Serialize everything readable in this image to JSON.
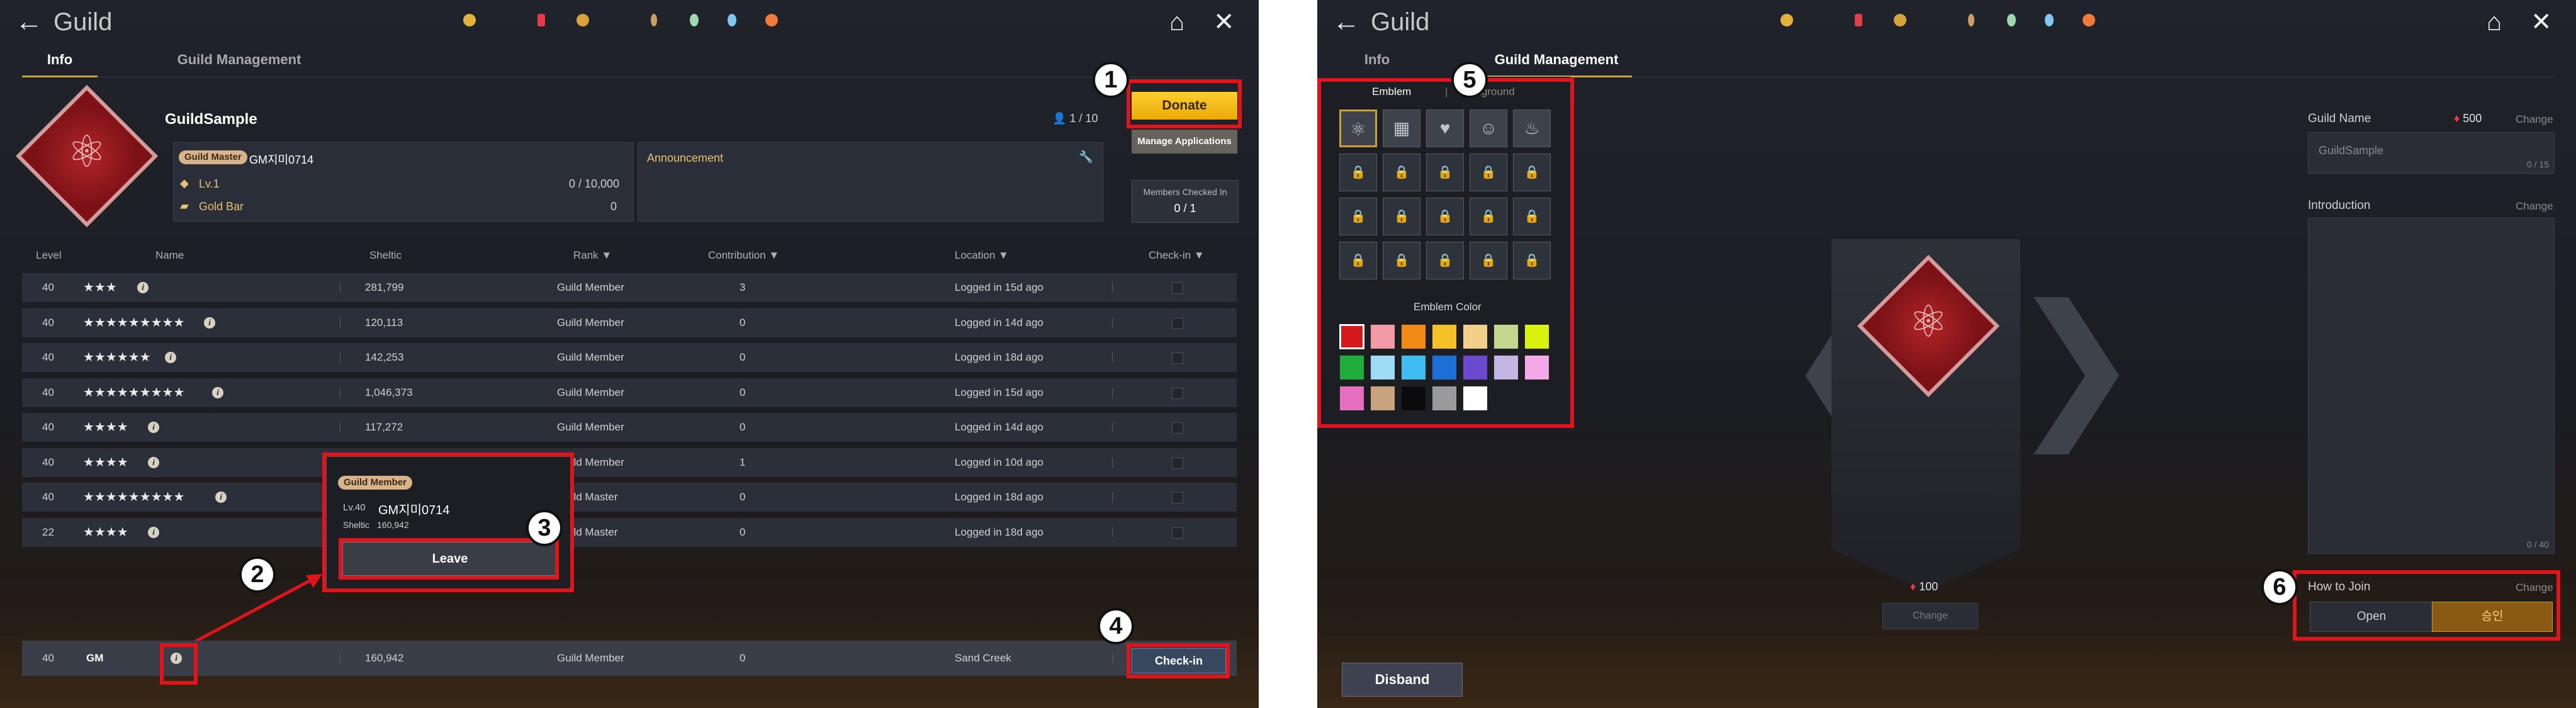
{
  "left": {
    "header": {
      "back_icon": "arrow-left-icon",
      "title": "Guild"
    },
    "tabs": [
      {
        "label": "Info",
        "active": true
      },
      {
        "label": "Guild Management",
        "active": false
      }
    ],
    "guild": {
      "name": "GuildSample",
      "member_count": "1 / 10",
      "master_badge": "Guild Master",
      "master_name": "GM지미0714",
      "level": "Lv.1",
      "exp": "0 / 10,000",
      "gold_bar_label": "Gold Bar",
      "gold_bar_value": "0",
      "announcement_label": "Announcement"
    },
    "buttons": {
      "donate": "Donate",
      "manage": "Manage Applications",
      "checked_label": "Members Checked In",
      "checked_value": "0 / 1",
      "checkin": "Check-in"
    },
    "table": {
      "headers": {
        "level": "Level",
        "name": "Name",
        "sheltic": "Sheltic",
        "rank": "Rank",
        "contribution": "Contribution",
        "location": "Location",
        "checkin": "Check-in"
      },
      "rows": [
        {
          "level": "40",
          "name": "★★★",
          "sheltic": "281,799",
          "rank": "Guild Member",
          "contribution": "3",
          "location": "Logged in 15d ago"
        },
        {
          "level": "40",
          "name": "★★★★★★★★★",
          "sheltic": "120,113",
          "rank": "Guild Member",
          "contribution": "0",
          "location": "Logged in 14d ago"
        },
        {
          "level": "40",
          "name": "★★★★★★",
          "sheltic": "142,253",
          "rank": "Guild Member",
          "contribution": "0",
          "location": "Logged in 18d ago"
        },
        {
          "level": "40",
          "name": "★★★★★★★★★",
          "sheltic": "1,046,373",
          "rank": "Guild Member",
          "contribution": "0",
          "location": "Logged in 15d ago"
        },
        {
          "level": "40",
          "name": "★★★★",
          "sheltic": "117,272",
          "rank": "Guild Member",
          "contribution": "0",
          "location": "Logged in 14d ago"
        },
        {
          "level": "40",
          "name": "★★★★",
          "sheltic": "",
          "rank": "Guild Member",
          "contribution": "1",
          "location": "Logged in 10d ago"
        },
        {
          "level": "40",
          "name": "★★★★★★★★★",
          "sheltic": "",
          "rank": "Guild Master",
          "contribution": "0",
          "location": "Logged in 18d ago"
        },
        {
          "level": "22",
          "name": "★★★★",
          "sheltic": "",
          "rank": "Guild Master",
          "contribution": "0",
          "location": "Logged in 18d ago"
        }
      ]
    },
    "popup": {
      "badge": "Guild Member",
      "level": "Lv.40",
      "name": "GM지미0714",
      "sheltic_label": "Sheltic",
      "sheltic": "160,942",
      "leave": "Leave"
    },
    "gm_row": {
      "level": "40",
      "name": "GM",
      "sheltic": "160,942",
      "rank": "Guild Member",
      "contribution": "0",
      "location": "Sand Creek"
    }
  },
  "right": {
    "header": {
      "title": "Guild"
    },
    "tabs": [
      {
        "label": "Info",
        "active": false
      },
      {
        "label": "Guild Management",
        "active": true
      }
    ],
    "emblem_tabs": {
      "emblem": "Emblem",
      "background": "Background"
    },
    "emblem_color_label": "Emblem Color",
    "swatch_colors": [
      "#d4191c",
      "#f39aa8",
      "#f28a18",
      "#f4c128",
      "#f3d08a",
      "#c3d88e",
      "#d8f20d",
      "#1fae3a",
      "#9ddcf3",
      "#3dbdf0",
      "#1c6fd6",
      "#6c4ad0",
      "#c3b5e4",
      "#f3a8e8",
      "#e76fbf",
      "#c8a47e",
      "#0b0b0b",
      "#9a9a9a",
      "#ffffff"
    ],
    "guild_name_label": "Guild Name",
    "guild_name_cost": "500",
    "guild_name_change": "Change",
    "guild_name_value": "GuildSample",
    "guild_name_count": "0 / 15",
    "intro_label": "Introduction",
    "intro_change": "Change",
    "intro_count": "0 / 40",
    "banner_cost": "100",
    "banner_change": "Change",
    "how_to_join_label": "How to Join",
    "how_to_join_change": "Change",
    "join_open": "Open",
    "join_approval": "승인",
    "disband": "Disband"
  },
  "callouts": [
    "1",
    "2",
    "3",
    "4",
    "5",
    "6"
  ]
}
